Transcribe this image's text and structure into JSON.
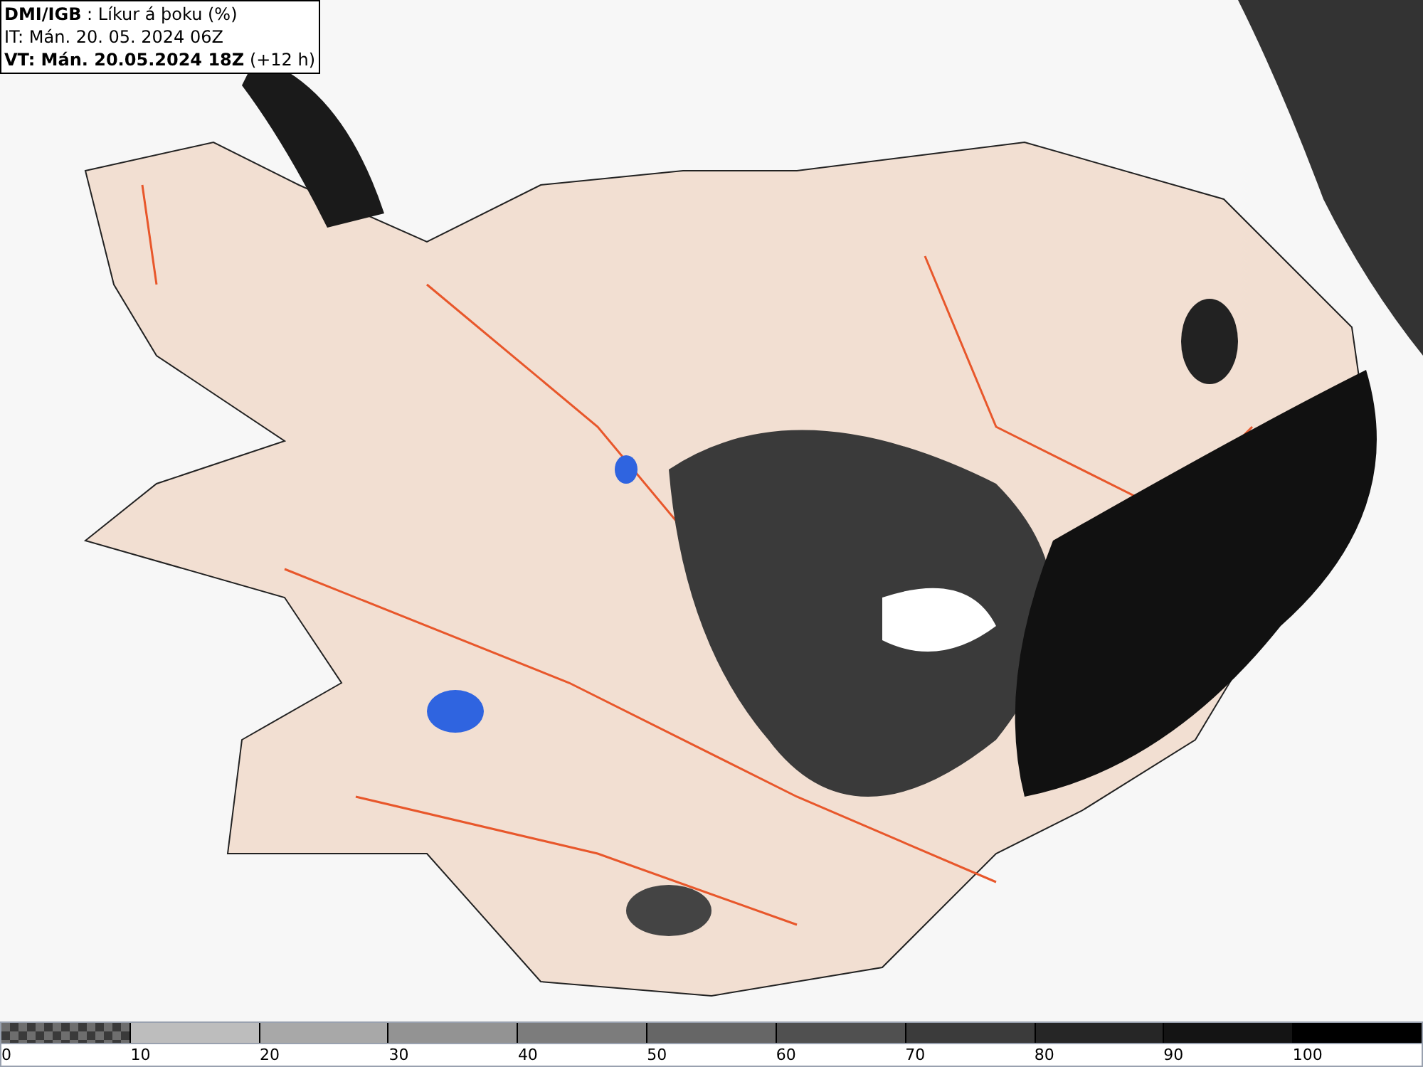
{
  "header": {
    "source": "DMI/IGB",
    "separator": ":",
    "title": "Líkur á þoku (%)",
    "issue_time": "IT: Mán. 20. 05. 2024 06Z",
    "valid_label": "VT: Mán. 20.05.2024 18Z",
    "lead": "(+12 h)"
  },
  "legend": [
    {
      "label": "0",
      "kind": "pattern",
      "color": "#6e6e6e"
    },
    {
      "label": "10",
      "kind": "solid",
      "color": "#bdbdbd"
    },
    {
      "label": "20",
      "kind": "solid",
      "color": "#a8a8a8"
    },
    {
      "label": "30",
      "kind": "solid",
      "color": "#939393"
    },
    {
      "label": "40",
      "kind": "solid",
      "color": "#7c7c7c"
    },
    {
      "label": "50",
      "kind": "solid",
      "color": "#666666"
    },
    {
      "label": "60",
      "kind": "solid",
      "color": "#505050"
    },
    {
      "label": "70",
      "kind": "solid",
      "color": "#3b3b3b"
    },
    {
      "label": "80",
      "kind": "solid",
      "color": "#262626"
    },
    {
      "label": "90",
      "kind": "solid",
      "color": "#141414"
    },
    {
      "label": "100",
      "kind": "solid",
      "color": "#000000"
    }
  ]
}
